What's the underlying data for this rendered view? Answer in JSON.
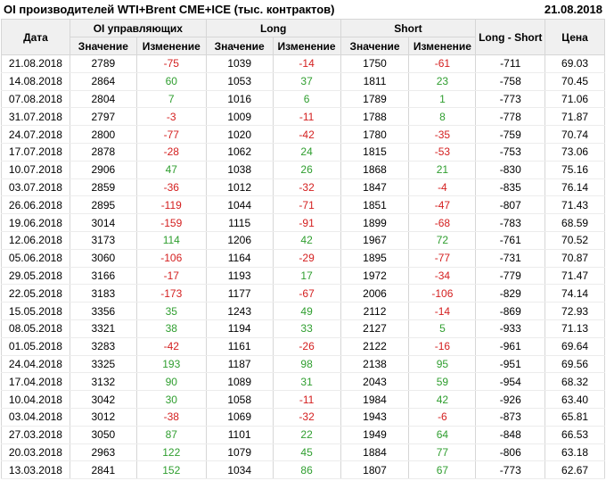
{
  "header": {
    "title": "OI производителей WTI+Brent CME+ICE (тыс. контрактов)",
    "date": "21.08.2018"
  },
  "columns": {
    "date": "Дата",
    "oi_group": "OI управляющих",
    "long_group": "Long",
    "short_group": "Short",
    "long_short": "Long - Short",
    "price": "Цена",
    "value": "Значение",
    "change": "Изменение"
  },
  "colors": {
    "positive": "#2f9e2f",
    "negative": "#d42020"
  },
  "rows": [
    {
      "date": "21.08.2018",
      "oi": "2789",
      "oi_ch": "-75",
      "long": "1039",
      "long_ch": "-14",
      "short": "1750",
      "short_ch": "-61",
      "ls": "-711",
      "price": "69.03"
    },
    {
      "date": "14.08.2018",
      "oi": "2864",
      "oi_ch": "60",
      "long": "1053",
      "long_ch": "37",
      "short": "1811",
      "short_ch": "23",
      "ls": "-758",
      "price": "70.45"
    },
    {
      "date": "07.08.2018",
      "oi": "2804",
      "oi_ch": "7",
      "long": "1016",
      "long_ch": "6",
      "short": "1789",
      "short_ch": "1",
      "ls": "-773",
      "price": "71.06"
    },
    {
      "date": "31.07.2018",
      "oi": "2797",
      "oi_ch": "-3",
      "long": "1009",
      "long_ch": "-11",
      "short": "1788",
      "short_ch": "8",
      "ls": "-778",
      "price": "71.87"
    },
    {
      "date": "24.07.2018",
      "oi": "2800",
      "oi_ch": "-77",
      "long": "1020",
      "long_ch": "-42",
      "short": "1780",
      "short_ch": "-35",
      "ls": "-759",
      "price": "70.74",
      "sep": true
    },
    {
      "date": "17.07.2018",
      "oi": "2878",
      "oi_ch": "-28",
      "long": "1062",
      "long_ch": "24",
      "short": "1815",
      "short_ch": "-53",
      "ls": "-753",
      "price": "73.06"
    },
    {
      "date": "10.07.2018",
      "oi": "2906",
      "oi_ch": "47",
      "long": "1038",
      "long_ch": "26",
      "short": "1868",
      "short_ch": "21",
      "ls": "-830",
      "price": "75.16"
    },
    {
      "date": "03.07.2018",
      "oi": "2859",
      "oi_ch": "-36",
      "long": "1012",
      "long_ch": "-32",
      "short": "1847",
      "short_ch": "-4",
      "ls": "-835",
      "price": "76.14"
    },
    {
      "date": "26.06.2018",
      "oi": "2895",
      "oi_ch": "-119",
      "long": "1044",
      "long_ch": "-71",
      "short": "1851",
      "short_ch": "-47",
      "ls": "-807",
      "price": "71.43"
    },
    {
      "date": "19.06.2018",
      "oi": "3014",
      "oi_ch": "-159",
      "long": "1115",
      "long_ch": "-91",
      "short": "1899",
      "short_ch": "-68",
      "ls": "-783",
      "price": "68.59"
    },
    {
      "date": "12.06.2018",
      "oi": "3173",
      "oi_ch": "114",
      "long": "1206",
      "long_ch": "42",
      "short": "1967",
      "short_ch": "72",
      "ls": "-761",
      "price": "70.52"
    },
    {
      "date": "05.06.2018",
      "oi": "3060",
      "oi_ch": "-106",
      "long": "1164",
      "long_ch": "-29",
      "short": "1895",
      "short_ch": "-77",
      "ls": "-731",
      "price": "70.87"
    },
    {
      "date": "29.05.2018",
      "oi": "3166",
      "oi_ch": "-17",
      "long": "1193",
      "long_ch": "17",
      "short": "1972",
      "short_ch": "-34",
      "ls": "-779",
      "price": "71.47"
    },
    {
      "date": "22.05.2018",
      "oi": "3183",
      "oi_ch": "-173",
      "long": "1177",
      "long_ch": "-67",
      "short": "2006",
      "short_ch": "-106",
      "ls": "-829",
      "price": "74.14"
    },
    {
      "date": "15.05.2018",
      "oi": "3356",
      "oi_ch": "35",
      "long": "1243",
      "long_ch": "49",
      "short": "2112",
      "short_ch": "-14",
      "ls": "-869",
      "price": "72.93"
    },
    {
      "date": "08.05.2018",
      "oi": "3321",
      "oi_ch": "38",
      "long": "1194",
      "long_ch": "33",
      "short": "2127",
      "short_ch": "5",
      "ls": "-933",
      "price": "71.13"
    },
    {
      "date": "01.05.2018",
      "oi": "3283",
      "oi_ch": "-42",
      "long": "1161",
      "long_ch": "-26",
      "short": "2122",
      "short_ch": "-16",
      "ls": "-961",
      "price": "69.64"
    },
    {
      "date": "24.04.2018",
      "oi": "3325",
      "oi_ch": "193",
      "long": "1187",
      "long_ch": "98",
      "short": "2138",
      "short_ch": "95",
      "ls": "-951",
      "price": "69.56",
      "sep": true
    },
    {
      "date": "17.04.2018",
      "oi": "3132",
      "oi_ch": "90",
      "long": "1089",
      "long_ch": "31",
      "short": "2043",
      "short_ch": "59",
      "ls": "-954",
      "price": "68.32"
    },
    {
      "date": "10.04.2018",
      "oi": "3042",
      "oi_ch": "30",
      "long": "1058",
      "long_ch": "-11",
      "short": "1984",
      "short_ch": "42",
      "ls": "-926",
      "price": "63.40"
    },
    {
      "date": "03.04.2018",
      "oi": "3012",
      "oi_ch": "-38",
      "long": "1069",
      "long_ch": "-32",
      "short": "1943",
      "short_ch": "-6",
      "ls": "-873",
      "price": "65.81"
    },
    {
      "date": "27.03.2018",
      "oi": "3050",
      "oi_ch": "87",
      "long": "1101",
      "long_ch": "22",
      "short": "1949",
      "short_ch": "64",
      "ls": "-848",
      "price": "66.53"
    },
    {
      "date": "20.03.2018",
      "oi": "2963",
      "oi_ch": "122",
      "long": "1079",
      "long_ch": "45",
      "short": "1884",
      "short_ch": "77",
      "ls": "-806",
      "price": "63.18"
    },
    {
      "date": "13.03.2018",
      "oi": "2841",
      "oi_ch": "152",
      "long": "1034",
      "long_ch": "86",
      "short": "1807",
      "short_ch": "67",
      "ls": "-773",
      "price": "62.67"
    }
  ]
}
